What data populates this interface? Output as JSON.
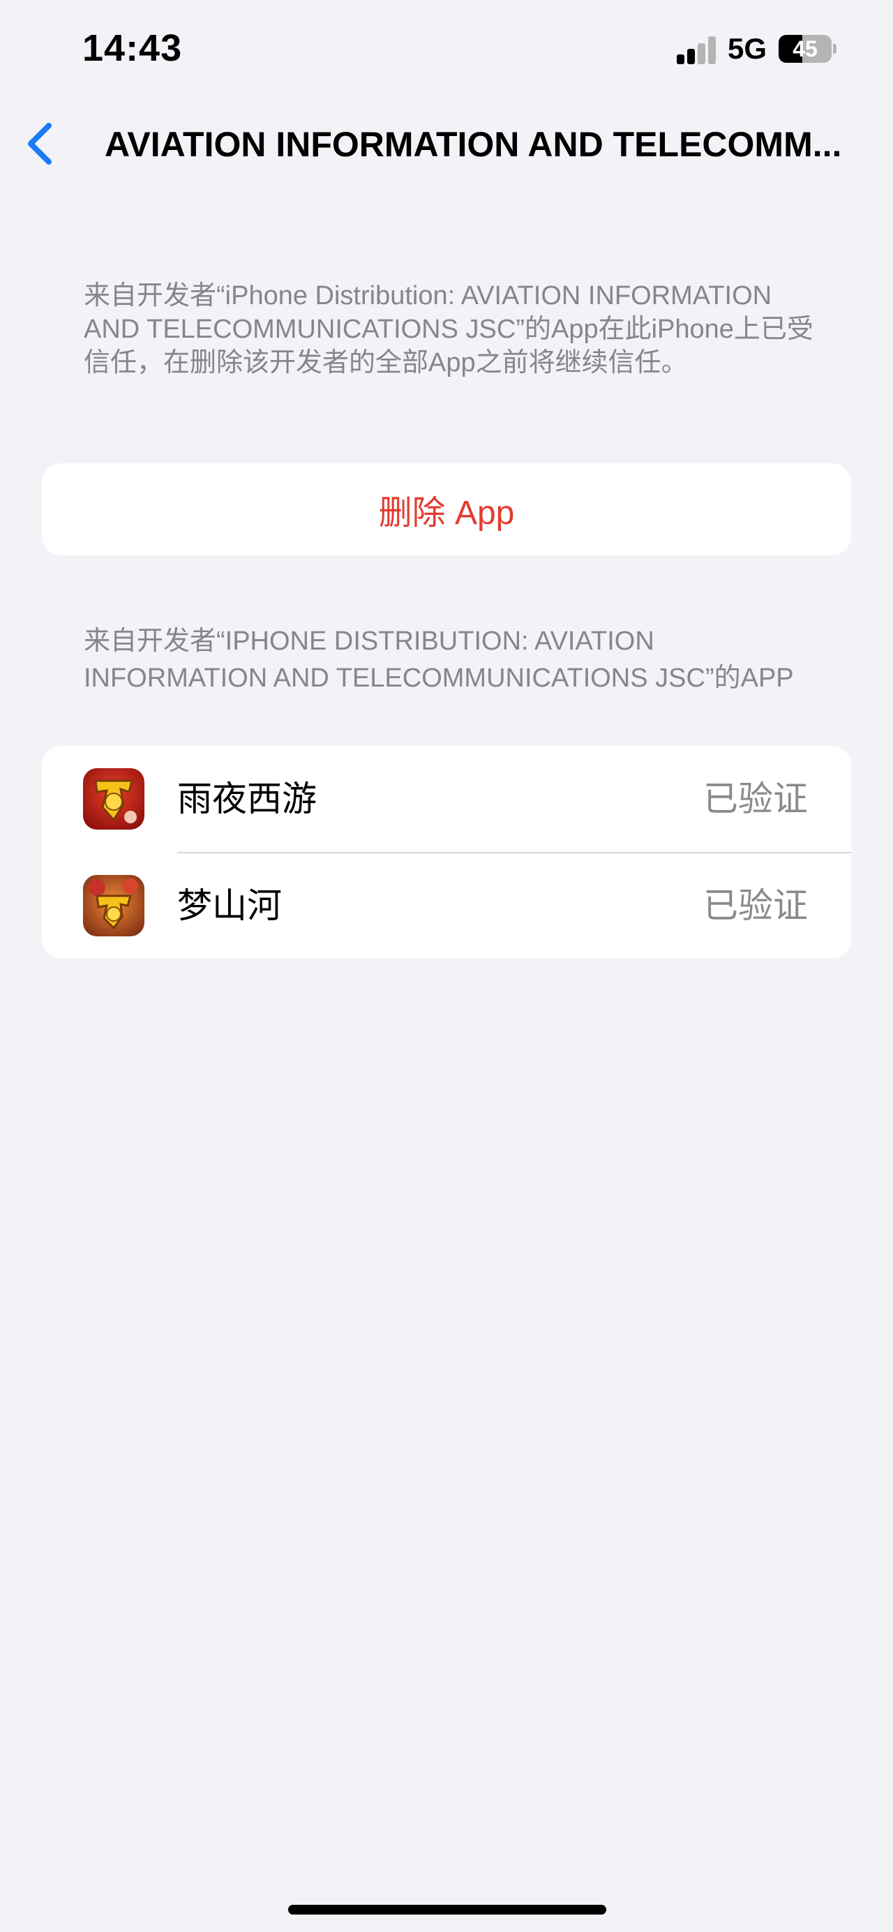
{
  "status_bar": {
    "time": "14:43",
    "network": "5G",
    "battery_level": "45",
    "battery_fraction": 0.45,
    "signal_bars_active": 2,
    "signal_bars_total": 4
  },
  "nav": {
    "back_icon": "chevron-left-icon",
    "title": "AVIATION INFORMATION AND TELECOMM..."
  },
  "trust_section": {
    "description": "来自开发者“iPhone Distribution: AVIATION INFORMATION AND TELECOMMUNICATIONS JSC”的App在此iPhone上已受信任，在删除该开发者的全部App之前将继续信任。",
    "delete_label": "删除 App"
  },
  "apps_section": {
    "header": "来自开发者“IPHONE DISTRIBUTION: AVIATION INFORMATION AND TELECOMMUNICATIONS JSC”的APP",
    "apps": [
      {
        "name": "雨夜西游",
        "status": "已验证",
        "icon": "game-app-icon"
      },
      {
        "name": "梦山河",
        "status": "已验证",
        "icon": "game-app-icon"
      }
    ]
  },
  "colors": {
    "background": "#f2f2f7",
    "accent_blue": "#1a7cf5",
    "destructive_red": "#e33b30",
    "secondary_text": "#85858a"
  }
}
